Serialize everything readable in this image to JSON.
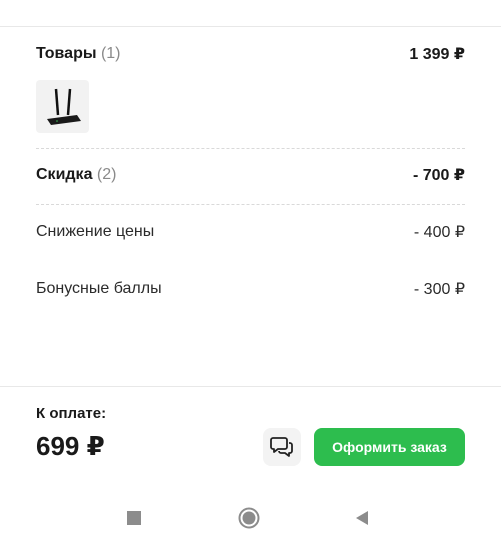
{
  "summary": {
    "goods": {
      "label": "Товары",
      "count": "(1)",
      "amount": "1 399 ₽"
    },
    "discount": {
      "label": "Скидка",
      "count": "(2)",
      "amount": "- 700 ₽"
    },
    "discount_items": [
      {
        "label": "Снижение цены",
        "amount": "- 400 ₽"
      },
      {
        "label": "Бонусные баллы",
        "amount": "- 300 ₽"
      }
    ]
  },
  "payment": {
    "label": "К оплате:",
    "total": "699 ₽",
    "order_button": "Оформить заказ"
  },
  "icons": {
    "product": "router-thumbnail",
    "chat": "chat-icon",
    "nav_recent": "square-icon",
    "nav_home": "circle-icon",
    "nav_back": "triangle-back-icon"
  },
  "colors": {
    "accent": "#2dbd4e",
    "muted": "#8a8a8a"
  }
}
